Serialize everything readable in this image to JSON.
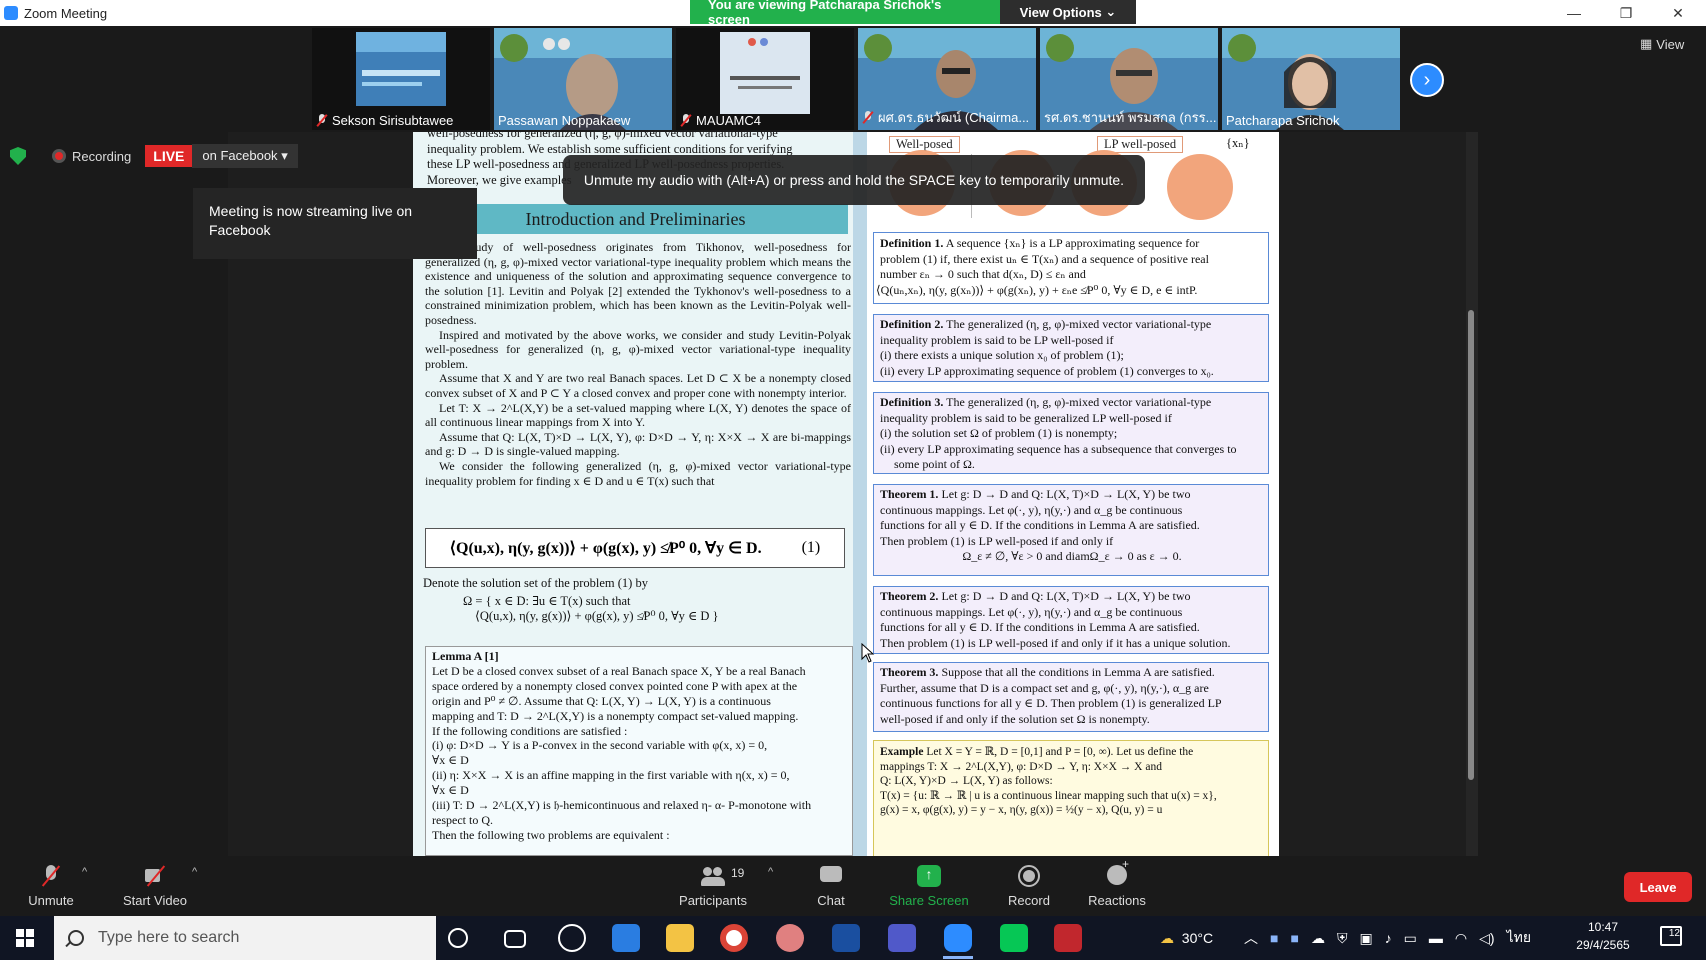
{
  "window": {
    "title": "Zoom Meeting",
    "viewing_banner": "You are viewing Patcharapa Srichok's screen",
    "view_options": "View Options",
    "view_label": "View",
    "controls": {
      "minimize": "—",
      "restore": "❐",
      "close": "✕"
    }
  },
  "participants_strip": [
    {
      "name": "Sekson Sirisubtawee",
      "muted": true
    },
    {
      "name": "Passawan Noppakaew",
      "muted": false
    },
    {
      "name": "MAUAMC4",
      "muted": true
    },
    {
      "name": "ผศ.ดร.ธนวัฒน์ (Chairma...",
      "muted": true
    },
    {
      "name": "รศ.ดร.ชานนท์ พรมสกล (กรร...",
      "muted": false
    },
    {
      "name": "Patcharapa Srichok",
      "muted": false
    }
  ],
  "status": {
    "recording_label": "Recording",
    "live_label": "LIVE",
    "facebook_label": "on Facebook",
    "stream_tooltip": "Meeting is now streaming live on Facebook",
    "unmute_tip": "Unmute my audio with (Alt+A) or press and hold the SPACE key to temporarily unmute."
  },
  "poster": {
    "top_lines": [
      "well-posedness for generalized (η, g, φ)-mixed vector variational-type",
      "inequality problem. We establish some sufficient conditions for verifying",
      "these LP well-posedness and generalized LP well-posedness properties.",
      "Moreover, we give examples"
    ],
    "intro_heading": "Introduction and Preliminaries",
    "intro_paragraphs": [
      "The study of well-posedness originates from Tikhonov, well-posedness for generalized (η, g, φ)-mixed vector variational-type inequality problem which means the existence and uniqueness of the solution and approximating sequence convergence to the solution [1]. Levitin and Polyak [2] extended the Tykhonov's well-posedness to a constrained minimization problem, which has been known as the Levitin-Polyak well-posedness.",
      "Inspired and motivated by the above works, we consider and study Levitin-Polyak well-posedness for generalized (η, g, φ)-mixed vector variational-type inequality problem.",
      "Assume that X and Y are two real Banach spaces. Let D ⊂ X be a nonempty closed convex subset of X and P ⊂ Y a closed convex and proper cone with nonempty interior.",
      "Let T: X → 2^L(X,Y) be a set-valued mapping where L(X, Y) denotes the space of all continuous linear mappings from X into Y.",
      "Assume that Q: L(X, T)×D → L(X, Y), φ: D×D → Y, η: X×X → X are bi-mappings and g: D → D is single-valued mapping.",
      "We consider the following generalized (η, g, φ)-mixed vector variational-type inequality problem for finding x ∈ D and u ∈ T(x) such that"
    ],
    "main_equation": "⟨Q(u,x), η(y, g(x))⟩ + φ(g(x), y) ≰P⁰ 0, ∀y ∈ D.",
    "main_equation_number": "(1)",
    "solution_set_intro": "Denote the solution set of the problem (1) by",
    "solution_set_line1": "Ω = { x ∈ D: ∃u ∈ T(x) such that",
    "solution_set_line2": "⟨Q(u,x), η(y, g(x))⟩ + φ(g(x), y) ≰P⁰ 0, ∀y ∈ D }",
    "lemma_title": "Lemma A [1]",
    "lemma_lines": [
      "Let D be a closed convex subset of a real Banach space X, Y be a real Banach",
      "space ordered by a nonempty closed convex pointed cone P with apex at the",
      "origin and P⁰ ≠ ∅. Assume that Q: L(X, Y) → L(X, Y) is a continuous",
      "mapping and T: D → 2^L(X,Y) is a nonempty compact set-valued mapping.",
      "If the following conditions are satisfied :",
      "(i) φ: D×D → Y is a P-convex in the second variable with φ(x, x) = 0,",
      "     ∀x ∈ D",
      "(ii) η: X×X → X is an affine mapping in the first variable with η(x, x) = 0,",
      "     ∀x ∈ D",
      "(iii) T: D → 2^L(X,Y) is 𝔥-hemicontinuous and relaxed η- α- P-monotone with",
      "     respect to Q.",
      "Then the following two problems are equivalent :"
    ],
    "wellposed_tag": "Well-posed",
    "lp_wellposed_tag": "LP well-posed",
    "seq_label": "{xₙ}",
    "definitions": [
      {
        "title": "Definition 1.",
        "lines": [
          "A sequence {xₙ} is a LP approximating sequence for",
          "problem (1) if, there exist uₙ ∈ T(xₙ) and a sequence of positive real",
          "number εₙ → 0 such that d(xₙ, D) ≤ εₙ and",
          "⟨Q(uₙ,xₙ), η(y, g(xₙ))⟩ + φ(g(xₙ), y) + εₙe ≰P⁰ 0, ∀y ∈ D, e ∈ intP."
        ]
      },
      {
        "title": "Definition 2.",
        "lines": [
          "The generalized (η, g, φ)-mixed vector variational-type",
          "inequality problem is said to be LP well-posed if",
          "(i) there exists a unique solution x₀ of problem (1);",
          "(ii) every LP approximating sequence of problem (1) converges to x₀."
        ]
      },
      {
        "title": "Definition 3.",
        "lines": [
          "The generalized (η, g, φ)-mixed vector variational-type",
          "inequality problem is said to be generalized LP well-posed if",
          "(i) the solution set Ω of problem (1) is nonempty;",
          "(ii) every LP approximating sequence has a subsequence that converges to",
          "     some point of Ω."
        ]
      },
      {
        "title": "Theorem 1.",
        "lines": [
          "Let g: D → D and Q: L(X, T)×D → L(X, Y) be two",
          "continuous mappings. Let φ(·, y), η(y,·) and α_g be continuous",
          "functions for all y ∈ D. If the conditions in Lemma A are satisfied.",
          "Then problem (1) is LP well-posed if and only if",
          "Ω_ε ≠ ∅, ∀ε > 0  and  diamΩ_ε → 0 as ε → 0."
        ]
      },
      {
        "title": "Theorem 2.",
        "lines": [
          "Let g: D → D and Q: L(X, T)×D → L(X, Y) be two",
          "continuous mappings. Let φ(·, y), η(y,·) and α_g be continuous",
          "functions for all y ∈ D. If the conditions in Lemma A are satisfied.",
          "Then problem (1) is LP well-posed if and only if it has a unique solution."
        ]
      },
      {
        "title": "Theorem 3.",
        "lines": [
          "Suppose that all the conditions in Lemma A are satisfied.",
          "Further, assume that D is a compact set and g, φ(·, y), η(y,·), α_g are",
          "continuous functions for all y ∈ D. Then problem (1) is generalized LP",
          "well-posed if and only if the solution set Ω is nonempty."
        ]
      },
      {
        "title": "Example",
        "lines": [
          "Let X = Y = ℝ, D = [0,1] and P = [0, ∞). Let us define the",
          "mappings T: X → 2^L(X,Y), φ: D×D → Y, η: X×X → X and",
          "Q: L(X, Y)×D → L(X, Y) as follows:",
          "T(x) = {u: ℝ → ℝ | u is a continuous linear mapping such that u(x) = x},",
          "g(x) = x, φ(g(x), y) = y − x, η(y, g(x)) = ½(y − x), Q(u, y) = u"
        ]
      }
    ]
  },
  "toolbar": {
    "unmute": "Unmute",
    "start_video": "Start Video",
    "participants": "Participants",
    "participant_count": "19",
    "chat": "Chat",
    "share_screen": "Share Screen",
    "record": "Record",
    "reactions": "Reactions",
    "leave": "Leave"
  },
  "taskbar": {
    "search_placeholder": "Type here to search",
    "temperature": "30°C",
    "language": "ไทย",
    "time": "10:47",
    "date": "29/4/2565",
    "notification_count": "12"
  },
  "colors": {
    "zoom_blue": "#2d8cff",
    "green": "#22b14c",
    "live_red": "#e02828"
  }
}
